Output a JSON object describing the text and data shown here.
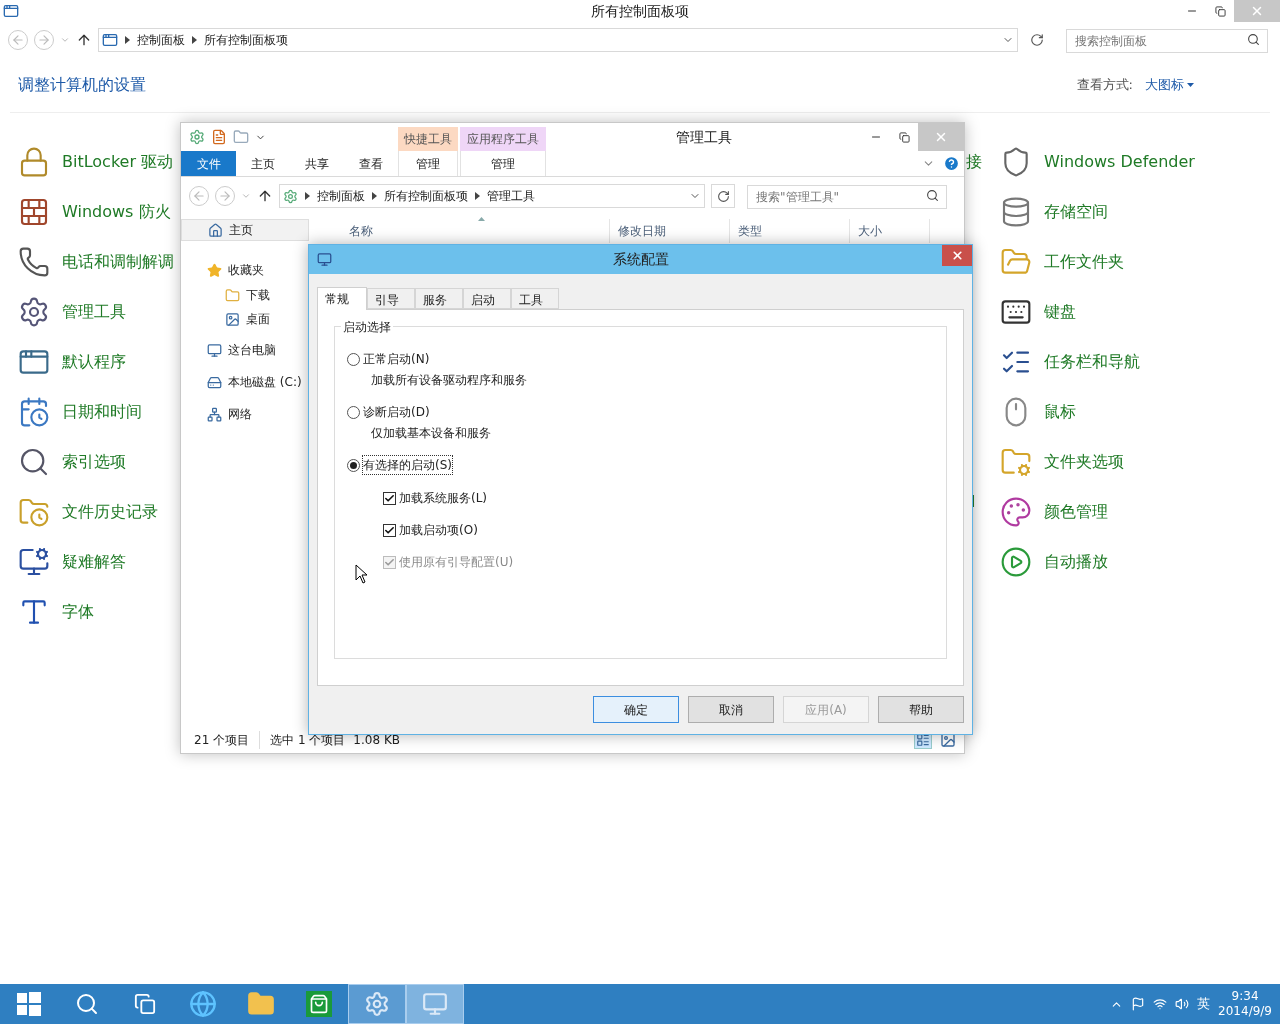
{
  "window": {
    "title": "所有控制面板项"
  },
  "address": {
    "breadcrumb": [
      "控制面板",
      "所有控制面板项"
    ],
    "search_placeholder": "搜索控制面板"
  },
  "header": {
    "title": "调整计算机的设置",
    "view_label": "查看方式:",
    "view_value": "大图标"
  },
  "left_items": [
    "BitLocker 驱动",
    "Windows 防火",
    "电话和调制解调",
    "管理工具",
    "默认程序",
    "日期和时间",
    "索引选项",
    "文件历史记录",
    "疑难解答",
    "字体"
  ],
  "middle_fragments": [
    "接",
    "l"
  ],
  "right_items": [
    "Windows Defender",
    "存储空间",
    "工作文件夹",
    "键盘",
    "任务栏和导航",
    "鼠标",
    "文件夹选项",
    "颜色管理",
    "自动播放"
  ],
  "explorer": {
    "title": "管理工具",
    "ribbon_tabs": [
      {
        "label": "文件",
        "kind": "file"
      },
      {
        "label": "主页",
        "kind": "tab"
      },
      {
        "label": "共享",
        "kind": "tab"
      },
      {
        "label": "查看",
        "kind": "tab"
      }
    ],
    "context_groups": [
      {
        "label": "快捷工具",
        "color": "#fcd9c2",
        "tab": "管理"
      },
      {
        "label": "应用程序工具",
        "color": "#efd6f7",
        "tab": "管理"
      }
    ],
    "breadcrumb": [
      "控制面板",
      "所有控制面板项",
      "管理工具"
    ],
    "search_placeholder": "搜索\"管理工具\"",
    "nav": [
      {
        "label": "主页",
        "selected": true
      },
      {
        "label": "收藏夹",
        "selected": false,
        "children": [
          {
            "label": "下载",
            "selected": false
          },
          {
            "label": "桌面",
            "selected": false
          }
        ]
      },
      {
        "label": "这台电脑",
        "selected": false
      },
      {
        "label": "本地磁盘 (C:)",
        "selected": false
      },
      {
        "label": "网络",
        "selected": false
      }
    ],
    "columns": [
      "名称",
      "修改日期",
      "类型",
      "大小"
    ],
    "status": [
      "21 个项目",
      "选中 1 个项目",
      "1.08 KB"
    ]
  },
  "dialog": {
    "title": "系统配置",
    "tabs": [
      {
        "label": "常规",
        "selected": true
      },
      {
        "label": "引导",
        "selected": false
      },
      {
        "label": "服务",
        "selected": false
      },
      {
        "label": "启动",
        "selected": false
      },
      {
        "label": "工具",
        "selected": false
      }
    ],
    "group": "启动选择",
    "options": [
      {
        "kind": "radio",
        "label": "正常启动(N)",
        "description": "加载所有设备驱动程序和服务",
        "selected": false
      },
      {
        "kind": "radio",
        "label": "诊断启动(D)",
        "description": "仅加载基本设备和服务",
        "selected": false
      },
      {
        "kind": "radio",
        "label": "有选择的启动(S)",
        "selected": true
      },
      {
        "kind": "checkbox",
        "label": "加载系统服务(L)",
        "checked": true,
        "disabled": false
      },
      {
        "kind": "checkbox",
        "label": "加载启动项(O)",
        "checked": true,
        "disabled": false
      },
      {
        "kind": "checkbox",
        "label": "使用原有引导配置(U)",
        "checked": true,
        "disabled": true
      }
    ],
    "buttons": [
      {
        "label": "确定",
        "default": true,
        "disabled": false
      },
      {
        "label": "取消",
        "default": false,
        "disabled": false
      },
      {
        "label": "应用(A)",
        "default": false,
        "disabled": true
      },
      {
        "label": "帮助",
        "default": false,
        "disabled": false
      }
    ]
  },
  "taskbar": {
    "apps": [
      {
        "running": false,
        "selected": false
      },
      {
        "running": false,
        "selected": false
      },
      {
        "running": false,
        "selected": false
      },
      {
        "running": false,
        "selected": false
      },
      {
        "running": false,
        "selected": false
      },
      {
        "running": false,
        "selected": false
      },
      {
        "running": true,
        "selected": false
      },
      {
        "running": true,
        "selected": true
      }
    ],
    "ime": "英",
    "time": "9:34",
    "date": "2014/9/9"
  }
}
